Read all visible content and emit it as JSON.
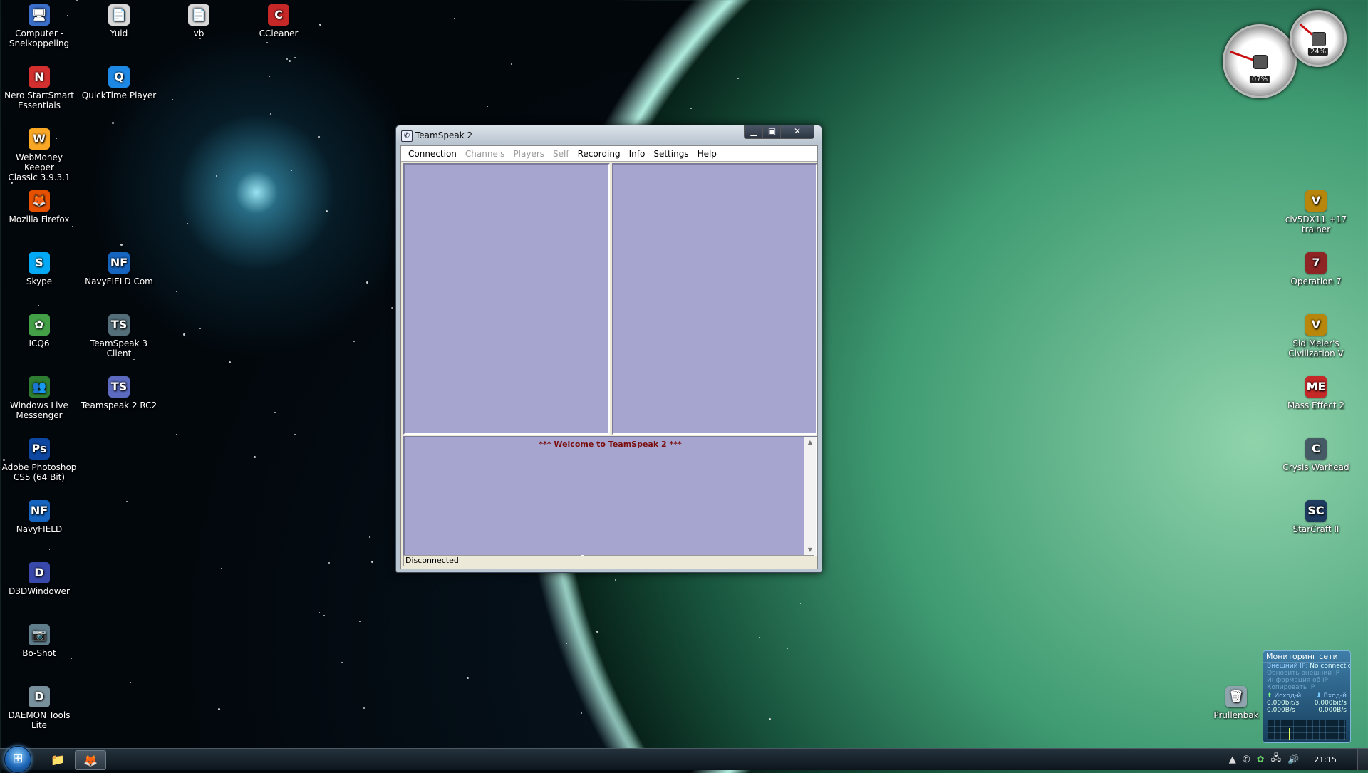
{
  "desktop_icons_left": [
    {
      "label": "Computer -\nSnelkoppeling",
      "glyph": "🖥",
      "color": "#3b6fc9"
    },
    {
      "label": "Yuid",
      "glyph": "📄",
      "color": "#d9d9d9"
    },
    {
      "label": "vb",
      "glyph": "📄",
      "color": "#d9d9d9"
    },
    {
      "label": "CCleaner",
      "glyph": "C",
      "color": "#c62828"
    },
    {
      "label": "Nero StartSmart\nEssentials",
      "glyph": "N",
      "color": "#d32f2f"
    },
    {
      "label": "QuickTime Player",
      "glyph": "Q",
      "color": "#1e88e5"
    },
    {
      "label": "WebMoney Keeper\nClassic 3.9.3.1",
      "glyph": "W",
      "color": "#f9a825"
    },
    {
      "label": "Mozilla Firefox",
      "glyph": "🦊",
      "color": "#e65100"
    },
    {
      "label": "Skype",
      "glyph": "S",
      "color": "#03a9f4"
    },
    {
      "label": "NavyFIELD Com",
      "glyph": "NF",
      "color": "#1565c0"
    },
    {
      "label": "ICQ6",
      "glyph": "✿",
      "color": "#43a047"
    },
    {
      "label": "TeamSpeak 3 Client",
      "glyph": "TS",
      "color": "#546e7a"
    },
    {
      "label": "Windows Live\nMessenger",
      "glyph": "👥",
      "color": "#2e7d32"
    },
    {
      "label": "Teamspeak 2 RC2",
      "glyph": "TS",
      "color": "#5c6bc0"
    },
    {
      "label": "Adobe Photoshop\nCS5 (64 Bit)",
      "glyph": "Ps",
      "color": "#0d47a1"
    },
    {
      "label": "NavyFIELD",
      "glyph": "NF",
      "color": "#1565c0"
    },
    {
      "label": "D3DWindower",
      "glyph": "D",
      "color": "#3949ab"
    },
    {
      "label": "Bo-Shot",
      "glyph": "📷",
      "color": "#607d8b"
    },
    {
      "label": "DAEMON Tools Lite",
      "glyph": "D",
      "color": "#78909c"
    }
  ],
  "desktop_icons_right": [
    {
      "label": "civ5DX11 +17 trainer",
      "glyph": "V",
      "color": "#b8860b"
    },
    {
      "label": "Operation 7",
      "glyph": "7",
      "color": "#8e2424"
    },
    {
      "label": "Sid Meier's\nCivilization V",
      "glyph": "V",
      "color": "#b8860b"
    },
    {
      "label": "Mass Effect 2",
      "glyph": "ME",
      "color": "#c62828"
    },
    {
      "label": "Crysis Warhead",
      "glyph": "C",
      "color": "#455a64"
    },
    {
      "label": "StarCraft II",
      "glyph": "SC",
      "color": "#1e3a5f"
    },
    {
      "label": "Prullenbak",
      "glyph": "🗑",
      "color": "#90a4ae"
    }
  ],
  "gadgets": {
    "cpu_percent": "07%",
    "ram_percent": "24%"
  },
  "netmon": {
    "title": "Мониторинг сети",
    "external_ip_label": "Внешний IP:",
    "external_ip_value": "No connection",
    "refresh": "Обновить внешний IP",
    "ip_info": "Информация об IP",
    "copy_ip": "Копировать IP",
    "out_label": "Исход-й",
    "in_label": "Вход-й",
    "out_rate_bits": "0.000bit/s",
    "in_rate_bits": "0.000bit/s",
    "out_rate_bytes": "0.000B/s",
    "in_rate_bytes": "0.000B/s"
  },
  "window": {
    "title": "TeamSpeak 2",
    "menu": [
      {
        "label": "Connection",
        "enabled": true
      },
      {
        "label": "Channels",
        "enabled": false
      },
      {
        "label": "Players",
        "enabled": false
      },
      {
        "label": "Self",
        "enabled": false
      },
      {
        "label": "Recording",
        "enabled": true
      },
      {
        "label": "Info",
        "enabled": true
      },
      {
        "label": "Settings",
        "enabled": true
      },
      {
        "label": "Help",
        "enabled": true
      }
    ],
    "log_message": "*** Welcome to TeamSpeak 2 ***",
    "status_text": "Disconnected",
    "status_text_2": ""
  },
  "taskbar": {
    "clock": "21:15",
    "tray_icons": [
      "chevron-up-icon",
      "teamspeak-tray-icon",
      "icq-tray-icon",
      "network-icon",
      "volume-icon"
    ]
  }
}
